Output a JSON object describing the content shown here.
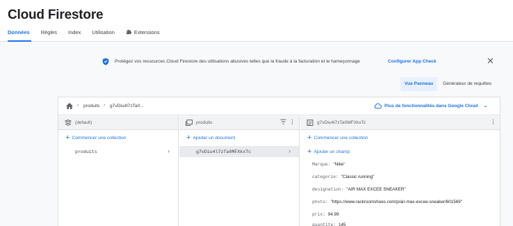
{
  "app": {
    "title": "Cloud Firestore"
  },
  "tabs": [
    {
      "label": "Données",
      "active": true
    },
    {
      "label": "Règles"
    },
    {
      "label": "Index"
    },
    {
      "label": "Utilisation"
    },
    {
      "label": "Extensions",
      "icon": "extensions-icon"
    }
  ],
  "banner": {
    "text": "Protégez vos ressources Cloud Firestore des utilisations abusives telles que la fraude à la facturation et le hameçonnage",
    "link": "Configurer App Check",
    "close": "✕",
    "icon": "shield-icon"
  },
  "view_toggle": {
    "panel": "Vue Panneau",
    "query": "Générateur de requêtes"
  },
  "breadcrumb": {
    "sep": "›",
    "collection": "produits",
    "doc": "g7vDiu4l7zTa0..."
  },
  "more_google_cloud": "Plus de fonctionnalités dans Google Cloud",
  "columns": {
    "root": {
      "header": "(default)",
      "action": "Commencer une collection",
      "items": [
        {
          "label": "produits",
          "arrow": "›"
        }
      ]
    },
    "collection": {
      "header": "produits",
      "action": "Ajouter un document",
      "items": [
        {
          "label": "g7vDiu4l7zTa0MFXkxTc",
          "arrow": "›"
        }
      ]
    },
    "document": {
      "header": "g7vDiu4l7zTa0MFXkxTc",
      "action_collection": "Commencer une collection",
      "action_field": "Ajouter un champ",
      "fields": [
        {
          "key": "Marque:",
          "value": "\"Nike\""
        },
        {
          "key": "categorie:",
          "value": "\"Classic running\""
        },
        {
          "key": "designation:",
          "value": "\"AIR MAX EXCEE SNEAKER\""
        },
        {
          "key": "photo:",
          "value": "\"https://www.rackroomshoes.com/p/air-max-excee-sneaker/601569\""
        },
        {
          "key": "prix:",
          "value": "94.99"
        },
        {
          "key": "quantite:",
          "value": "145"
        }
      ]
    }
  },
  "colors": {
    "accent": "#1a73e8",
    "border": "#dadce0",
    "header_bg": "#f1f3f4"
  }
}
